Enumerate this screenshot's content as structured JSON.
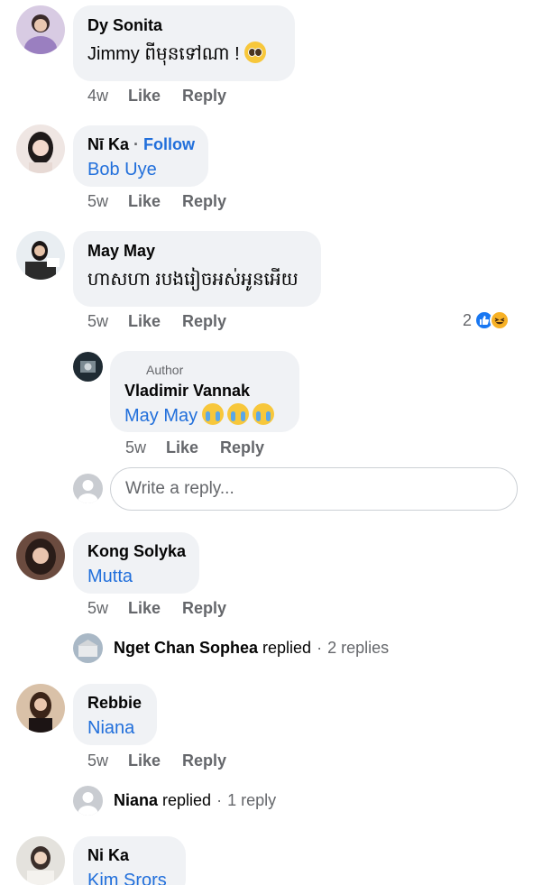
{
  "comments": [
    {
      "name": "Dy Sonita",
      "text": "Jimmy ពីមុនទៅណា !",
      "time": "4w",
      "like": "Like",
      "reply": "Reply"
    },
    {
      "name": "Nī Ka",
      "follow_sep": "·",
      "follow": "Follow",
      "mention": "Bob Uye",
      "time": "5w",
      "like": "Like",
      "reply": "Reply"
    },
    {
      "name": "May May",
      "text": "ហាសហា របងរៀចអស់អូនអើយ",
      "time": "5w",
      "like": "Like",
      "reply": "Reply",
      "reaction_count": "2"
    },
    {
      "name": "Kong Solyka",
      "mention": "Mutta",
      "time": "5w",
      "like": "Like",
      "reply": "Reply"
    },
    {
      "name": "Rebbie",
      "mention": "Niana",
      "time": "5w",
      "like": "Like",
      "reply": "Reply"
    },
    {
      "name": "Ni Ka",
      "mention": "Kim Srors"
    }
  ],
  "author_reply": {
    "badge": "Author",
    "name": "Vladimir Vannak",
    "mention": "May May",
    "time": "5w",
    "like": "Like",
    "reply": "Reply"
  },
  "reply_input": {
    "placeholder": "Write a reply..."
  },
  "replied_rows": [
    {
      "name": "Nget Chan Sophea",
      "verb": "replied",
      "sep": "·",
      "count": "2 replies"
    },
    {
      "name": "Niana",
      "verb": "replied",
      "sep": "·",
      "count": "1 reply"
    }
  ],
  "colors": {
    "bubble": "#f0f2f5",
    "link": "#216fdb",
    "meta": "#65676b"
  }
}
